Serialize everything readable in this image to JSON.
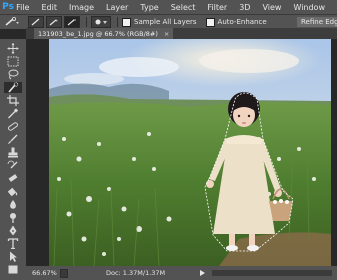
{
  "app": {
    "logo": "Ps"
  },
  "menu": [
    "File",
    "Edit",
    "Image",
    "Layer",
    "Type",
    "Select",
    "Filter",
    "3D",
    "View",
    "Window"
  ],
  "options": {
    "sample_all_layers": "Sample All Layers",
    "auto_enhance": "Auto-Enhance",
    "refine_edge": "Refine Edg"
  },
  "document_tab": {
    "title": "131903_be_1.jpg @ 66.7% (RGB/8#)",
    "close": "×"
  },
  "status": {
    "zoom": "66.67%",
    "doc": "Doc: 1.37M/1.37M"
  },
  "colors": {
    "accent": "#31a8ff",
    "chrome": "#535353",
    "canvas_bg": "#282828"
  }
}
